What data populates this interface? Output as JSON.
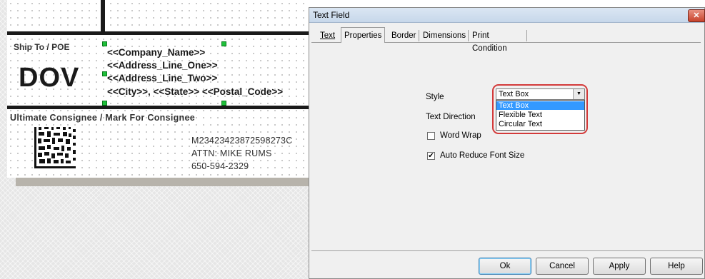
{
  "label": {
    "ship_to": "Ship To / POE",
    "port_code": "DOV",
    "address_lines": [
      "<<Company_Name>>",
      "<<Address_Line_One>>",
      "<<Address_Line_Two>>",
      "<<City>>, <<State>>  <<Postal_Code>>"
    ],
    "consignee_heading": "Ultimate Consignee / Mark For Consignee",
    "reference_lines": [
      "M23423423872598273C",
      "ATTN: MIKE RUMS",
      "650-594-2329"
    ]
  },
  "dialog": {
    "title": "Text Field",
    "close_glyph": "✕",
    "tabs": [
      "Text",
      "Properties",
      "Border",
      "Dimensions",
      "Print Condition"
    ],
    "active_tab": "Properties",
    "style_label": "Style",
    "style_value": "Text Box",
    "style_options": [
      "Text Box",
      "Flexible Text",
      "Circular Text"
    ],
    "text_direction_label": "Text Direction",
    "word_wrap_label": "Word Wrap",
    "word_wrap_checked": false,
    "auto_reduce_label": "Auto Reduce Font Size",
    "auto_reduce_checked": true,
    "buttons": {
      "ok": "Ok",
      "cancel": "Cancel",
      "apply": "Apply",
      "help": "Help"
    },
    "highlight_color": "#d33a3a",
    "selected_option_color": "#3399ff"
  }
}
